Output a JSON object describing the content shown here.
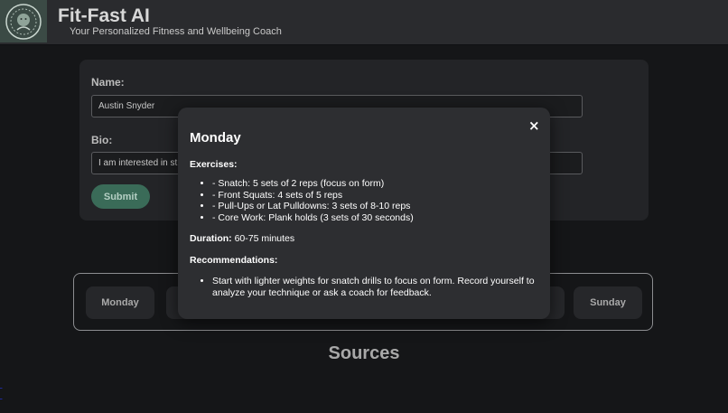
{
  "header": {
    "title": "Fit-Fast AI",
    "subtitle": "Your Personalized Fitness and Wellbeing Coach",
    "logo_icon": "lion-crest-icon"
  },
  "form": {
    "name_label": "Name:",
    "name_value": "Austin Snyder",
    "bio_label": "Bio:",
    "bio_value": "I am interested in st",
    "submit_label": "Submit"
  },
  "days": [
    {
      "label": "Monday"
    },
    {
      "label": "Sunday"
    }
  ],
  "sources": {
    "title": "Sources"
  },
  "modal": {
    "title": "Monday",
    "close_symbol": "×",
    "exercises_heading": "Exercises:",
    "exercises": [
      "- Snatch: 5 sets of 2 reps (focus on form)",
      "- Front Squats: 4 sets of 5 reps",
      "- Pull-Ups or Lat Pulldowns: 3 sets of 8-10 reps",
      "- Core Work: Plank holds (3 sets of 30 seconds)"
    ],
    "duration_label": "Duration:",
    "duration_value": " 60-75 minutes",
    "recommendations_heading": "Recommendations:",
    "recommendations": [
      "Start with lighter weights for snatch drills to focus on form. Record yourself to analyze your technique or ask a coach for feedback."
    ]
  },
  "colors": {
    "background": "#151618",
    "modal_bg": "#2d2e31",
    "accent": "#3a6b58",
    "link": "#1f2a9c"
  }
}
